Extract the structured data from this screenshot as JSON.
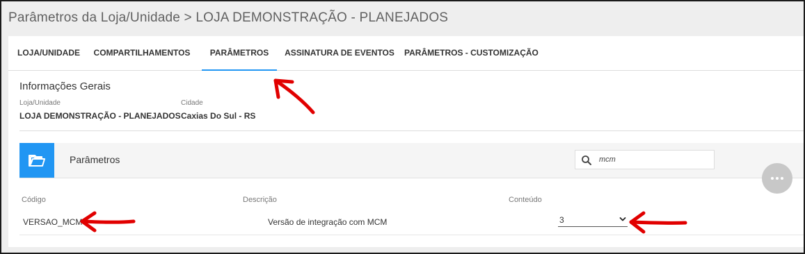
{
  "page": {
    "title": "Parâmetros da Loja/Unidade > LOJA DEMONSTRAÇÃO - PLANEJADOS"
  },
  "tabs": [
    {
      "label": "LOJA/UNIDADE",
      "active": false
    },
    {
      "label": "COMPARTILHAMENTOS",
      "active": false
    },
    {
      "label": "PARÂMETROS",
      "active": true
    },
    {
      "label": "ASSINATURA DE EVENTOS",
      "active": false
    },
    {
      "label": "PARÂMETROS - CUSTOMIZAÇÃO",
      "active": false
    }
  ],
  "info": {
    "title": "Informações Gerais",
    "store_label": "Loja/Unidade",
    "store_value": "LOJA DEMONSTRAÇÃO - PLANEJADOS",
    "city_label": "Cidade",
    "city_value": "Caxias Do Sul - RS"
  },
  "params": {
    "title": "Parâmetros",
    "search_value": "mcm",
    "columns": [
      "Código",
      "Descrição",
      "Conteúdo"
    ],
    "rows": [
      {
        "code": "VERSAO_MCM",
        "description": "Versão de integração com MCM",
        "content": "3"
      }
    ]
  },
  "icons": {
    "panel": "folder-open-icon",
    "search": "search-icon",
    "select": "chevron-down-icon",
    "more": "more-horizontal-icon",
    "annotation": "red-arrow-annotation"
  },
  "colors": {
    "accent": "#2196f3",
    "annotation": "#e10000",
    "fab": "#c8c8c8",
    "title_bar": "#eeeeee"
  }
}
